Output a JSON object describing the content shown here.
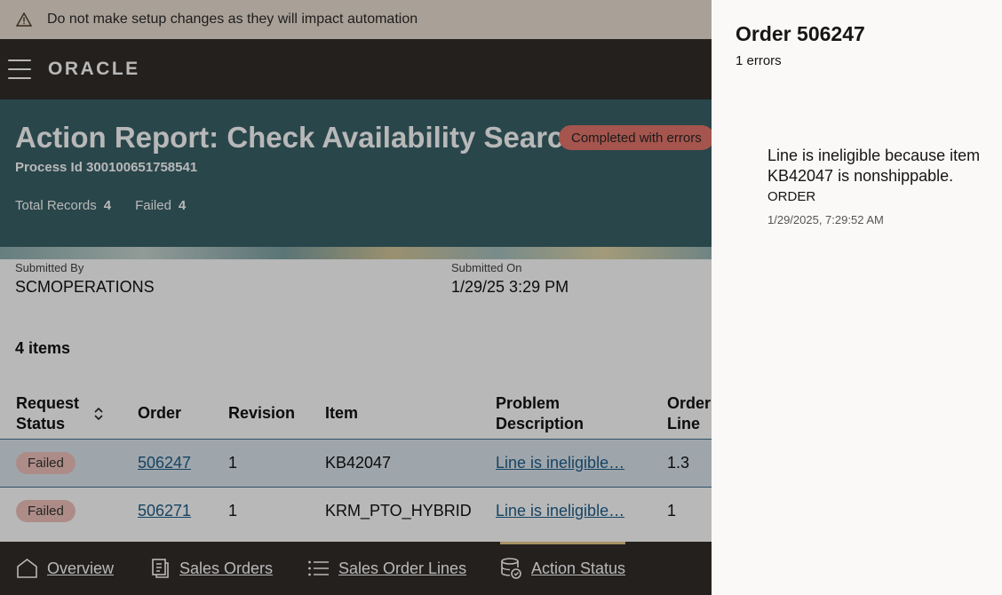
{
  "warning": {
    "text": "Do not make setup changes as they will impact automation"
  },
  "brand": {
    "logo": "ORACLE"
  },
  "report": {
    "title": "Action Report: Check Availability Search",
    "status_badge": "Completed with errors",
    "process_id": "Process Id 300100651758541",
    "total_records_label": "Total Records",
    "total_records": "4",
    "failed_label": "Failed",
    "failed": "4"
  },
  "meta": {
    "submitted_by_label": "Submitted By",
    "submitted_by": "SCMOPERATIONS",
    "submitted_on_label": "Submitted On",
    "submitted_on": "1/29/25 3:29 PM"
  },
  "items_count": "4 items",
  "table": {
    "headers": {
      "request_status": "Request Status",
      "order": "Order",
      "revision": "Revision",
      "item": "Item",
      "problem": "Problem Description",
      "order_line": "Order Line"
    },
    "rows": [
      {
        "status": "Failed",
        "order": "506247",
        "revision": "1",
        "item": "KB42047",
        "problem": "Line is ineligible…",
        "line": "1.3"
      },
      {
        "status": "Failed",
        "order": "506271",
        "revision": "1",
        "item": "KRM_PTO_HYBRID",
        "problem": "Line is ineligible…",
        "line": "1"
      }
    ]
  },
  "footer_tabs": [
    {
      "label": "Overview",
      "icon": "home-icon"
    },
    {
      "label": "Sales Orders",
      "icon": "document-icon"
    },
    {
      "label": "Sales Order Lines",
      "icon": "list-icon"
    },
    {
      "label": "Action Status",
      "icon": "database-sync-icon",
      "active": true
    }
  ],
  "drawer": {
    "title": "Order 506247",
    "subtitle": "1 errors",
    "message": "Line is ineligible because item KB42047 is nonshippable.",
    "category": "ORDER",
    "timestamp": "1/29/2025, 7:29:52 AM"
  },
  "colors": {
    "hero": "#3a6168",
    "navbar": "#312d2a",
    "warning_bg": "#eadfd2",
    "error_badge": "#e5776b",
    "failed_pill": "#f0c3bd",
    "link": "#1f5e8a",
    "selected_row": "#dde6ee"
  }
}
